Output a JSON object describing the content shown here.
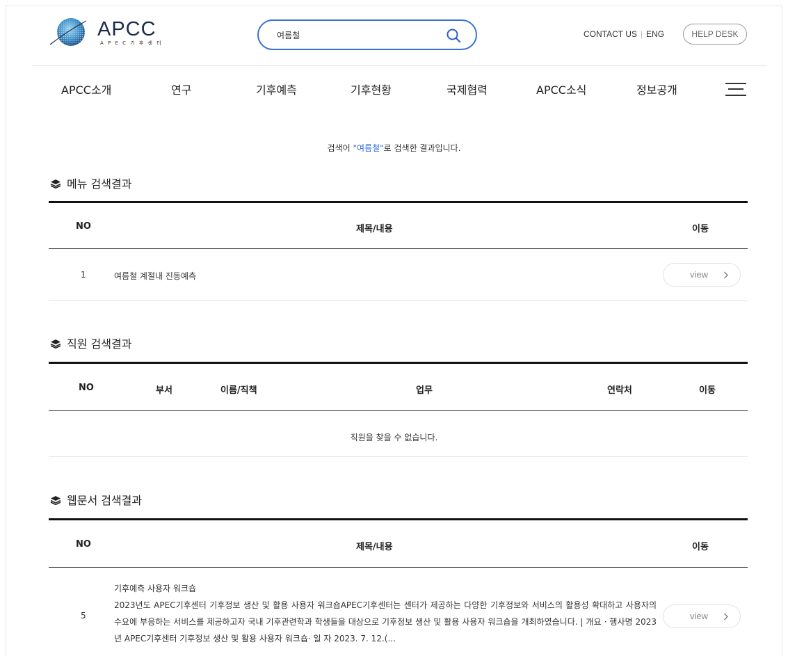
{
  "header": {
    "logo_text": "APCC",
    "logo_sub": "A P E C 기 후 센 터",
    "search_value": "여름철",
    "contact": "CONTACT US",
    "eng": "ENG",
    "separator": "|",
    "helpdesk": "HELP DESK",
    "accent_color": "#3a6fd8"
  },
  "nav": {
    "items": [
      "APCC소개",
      "연구",
      "기후예측",
      "기후현황",
      "국제협력",
      "APCC소식",
      "정보공개"
    ]
  },
  "result_msg": {
    "prefix": "검색어 ",
    "keyword": "\"여름철\"",
    "suffix": "로 검색한 결과입니다."
  },
  "menu_results": {
    "title": "메뉴 검색결과",
    "headers": {
      "no": "NO",
      "title": "제목/내용",
      "move": "이동"
    },
    "rows": [
      {
        "no": "1",
        "title": "여름철 계절내 진동예측",
        "button": "view"
      }
    ]
  },
  "staff_results": {
    "title": "직원 검색결과",
    "headers": {
      "no": "NO",
      "dept": "부서",
      "name": "이름/직책",
      "duty": "업무",
      "contact": "연락처",
      "move": "이동"
    },
    "empty": "직원을 찾을 수 없습니다."
  },
  "web_results": {
    "title": "웹문서 검색결과",
    "headers": {
      "no": "NO",
      "title": "제목/내용",
      "move": "이동"
    },
    "rows": [
      {
        "no": "5",
        "title": "기후예측 사용자 워크숍",
        "text": "2023년도 APEC기후센터 기후정보 생산 및 활용 사용자 워크숍APEC기후센터는 센터가 제공하는 다양한 기후정보와 서비스의 활용성 확대하고 사용자의 수요에 부응하는 서비스를 제공하고자 국내 기후관련학과 학생들을 대상으로 기후정보 생산 및 활용 사용자 워크숍을 개최하였습니다. | 개요 · 행사명 2023년 APEC기후센터 기후정보 생산 및 활용 사용자 워크숍· 일 자 2023. 7. 12.(...",
        "button": "view"
      }
    ]
  }
}
